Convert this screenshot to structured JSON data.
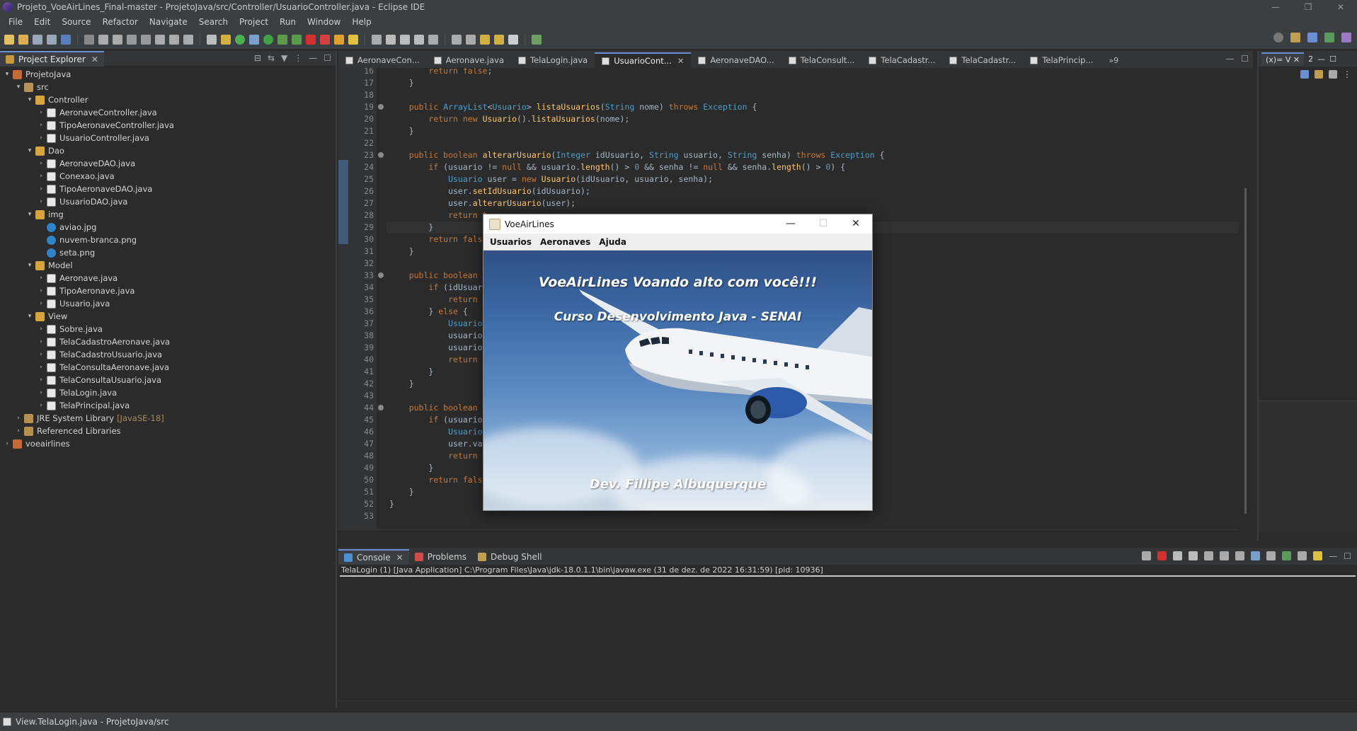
{
  "window": {
    "title": "Projeto_VoeAirLines_Final-master - ProjetoJava/src/Controller/UsuarioController.java - Eclipse IDE",
    "controls": [
      "—",
      "❐",
      "✕"
    ]
  },
  "menu": [
    "File",
    "Edit",
    "Source",
    "Refactor",
    "Navigate",
    "Search",
    "Project",
    "Run",
    "Window",
    "Help"
  ],
  "project_explorer": {
    "tab_label": "Project Explorer",
    "tree": [
      {
        "label": "ProjetoJava",
        "depth": 0,
        "arrow": "▾",
        "icon": "project",
        "name": "tree-project"
      },
      {
        "label": "src",
        "depth": 1,
        "arrow": "▾",
        "icon": "pkgfolder",
        "name": "tree-src"
      },
      {
        "label": "Controller",
        "depth": 2,
        "arrow": "▾",
        "icon": "package",
        "name": "tree-package"
      },
      {
        "label": "AeronaveController.java",
        "depth": 3,
        "arrow": "›",
        "icon": "java",
        "name": "tree-file"
      },
      {
        "label": "TipoAeronaveController.java",
        "depth": 3,
        "arrow": "›",
        "icon": "java",
        "name": "tree-file"
      },
      {
        "label": "UsuarioController.java",
        "depth": 3,
        "arrow": "›",
        "icon": "java",
        "name": "tree-file"
      },
      {
        "label": "Dao",
        "depth": 2,
        "arrow": "▾",
        "icon": "package",
        "name": "tree-package"
      },
      {
        "label": "AeronaveDAO.java",
        "depth": 3,
        "arrow": "›",
        "icon": "java",
        "name": "tree-file"
      },
      {
        "label": "Conexao.java",
        "depth": 3,
        "arrow": "›",
        "icon": "java",
        "name": "tree-file"
      },
      {
        "label": "TipoAeronaveDAO.java",
        "depth": 3,
        "arrow": "›",
        "icon": "java",
        "name": "tree-file"
      },
      {
        "label": "UsuarioDAO.java",
        "depth": 3,
        "arrow": "›",
        "icon": "java",
        "name": "tree-file"
      },
      {
        "label": "img",
        "depth": 2,
        "arrow": "▾",
        "icon": "package",
        "name": "tree-package"
      },
      {
        "label": "aviao.jpg",
        "depth": 3,
        "arrow": "",
        "icon": "image",
        "name": "tree-file"
      },
      {
        "label": "nuvem-branca.png",
        "depth": 3,
        "arrow": "",
        "icon": "image",
        "name": "tree-file"
      },
      {
        "label": "seta.png",
        "depth": 3,
        "arrow": "",
        "icon": "image",
        "name": "tree-file"
      },
      {
        "label": "Model",
        "depth": 2,
        "arrow": "▾",
        "icon": "package",
        "name": "tree-package"
      },
      {
        "label": "Aeronave.java",
        "depth": 3,
        "arrow": "›",
        "icon": "java",
        "name": "tree-file"
      },
      {
        "label": "TipoAeronave.java",
        "depth": 3,
        "arrow": "›",
        "icon": "java",
        "name": "tree-file"
      },
      {
        "label": "Usuario.java",
        "depth": 3,
        "arrow": "›",
        "icon": "java",
        "name": "tree-file"
      },
      {
        "label": "View",
        "depth": 2,
        "arrow": "▾",
        "icon": "package",
        "name": "tree-package"
      },
      {
        "label": "Sobre.java",
        "depth": 3,
        "arrow": "›",
        "icon": "java",
        "name": "tree-file"
      },
      {
        "label": "TelaCadastroAeronave.java",
        "depth": 3,
        "arrow": "›",
        "icon": "java",
        "name": "tree-file"
      },
      {
        "label": "TelaCadastroUsuario.java",
        "depth": 3,
        "arrow": "›",
        "icon": "java",
        "name": "tree-file"
      },
      {
        "label": "TelaConsultaAeronave.java",
        "depth": 3,
        "arrow": "›",
        "icon": "java",
        "name": "tree-file"
      },
      {
        "label": "TelaConsultaUsuario.java",
        "depth": 3,
        "arrow": "›",
        "icon": "java",
        "name": "tree-file"
      },
      {
        "label": "TelaLogin.java",
        "depth": 3,
        "arrow": "›",
        "icon": "java",
        "name": "tree-file"
      },
      {
        "label": "TelaPrincipal.java",
        "depth": 3,
        "arrow": "›",
        "icon": "java",
        "name": "tree-file"
      },
      {
        "label": "JRE System Library",
        "decor": "[JavaSE-18]",
        "depth": 1,
        "arrow": "›",
        "icon": "lib",
        "name": "tree-jre"
      },
      {
        "label": "Referenced Libraries",
        "depth": 1,
        "arrow": "›",
        "icon": "lib",
        "name": "tree-libs"
      },
      {
        "label": "voeairlines",
        "depth": 0,
        "arrow": "›",
        "icon": "project",
        "name": "tree-project"
      }
    ]
  },
  "editor": {
    "tabs": [
      {
        "label": "AeronaveCon...",
        "active": false
      },
      {
        "label": "Aeronave.java",
        "active": false
      },
      {
        "label": "TelaLogin.java",
        "active": false
      },
      {
        "label": "UsuarioCont...",
        "active": true
      },
      {
        "label": "AeronaveDAO...",
        "active": false
      },
      {
        "label": "TelaConsult...",
        "active": false
      },
      {
        "label": "TelaCadastr...",
        "active": false
      },
      {
        "label": "TelaCadastr...",
        "active": false
      },
      {
        "label": "TelaPrincip...",
        "active": false
      }
    ],
    "more_tabs": "»9",
    "lines": [
      {
        "n": "16",
        "html": "        <span class=\"kw\">return false</span>;"
      },
      {
        "n": "17",
        "html": "    }"
      },
      {
        "n": "18",
        "html": ""
      },
      {
        "n": "19",
        "fold": true,
        "html": "    <span class=\"kw\">public</span> <span class=\"ty\">ArrayList</span>&lt;<span class=\"ty\">Usuario</span>&gt; <span class=\"fn\">listaUsuarios</span>(<span class=\"ty\">String</span> nome) <span class=\"kw\">throws</span> <span class=\"ty\">Exception</span> {"
      },
      {
        "n": "20",
        "html": "        <span class=\"kw\">return new</span> <span class=\"fn\">Usuario</span>().<span class=\"fn\">listaUsuarios</span>(nome);"
      },
      {
        "n": "21",
        "html": "    }"
      },
      {
        "n": "22",
        "html": ""
      },
      {
        "n": "23",
        "fold": true,
        "html": "    <span class=\"kw\">public boolean</span> <span class=\"fn\">alterarUsuario</span>(<span class=\"ty\">Integer</span> idUsuario, <span class=\"ty\">String</span> usuario, <span class=\"ty\">String</span> senha) <span class=\"kw\">throws</span> <span class=\"ty\">Exception</span> {"
      },
      {
        "n": "24",
        "html": "        <span class=\"kw\">if</span> (usuario != <span class=\"kw\">null</span> &amp;&amp; usuario.<span class=\"fn\">length</span>() &gt; <span class=\"nm\">0</span> &amp;&amp; senha != <span class=\"kw\">null</span> &amp;&amp; senha.<span class=\"fn\">length</span>() &gt; <span class=\"nm\">0</span>) {"
      },
      {
        "n": "25",
        "html": "            <span class=\"ty\">Usuario</span> user = <span class=\"kw\">new</span> <span class=\"fn\">Usuario</span>(idUsuario, usuario, senha);"
      },
      {
        "n": "26",
        "html": "            user.<span class=\"fn\">setIdUsuario</span>(idUsuario);"
      },
      {
        "n": "27",
        "html": "            user.<span class=\"fn\">alterarUsuario</span>(user);"
      },
      {
        "n": "28",
        "html": "            <span class=\"kw\">return t</span>"
      },
      {
        "n": "29",
        "current": true,
        "html": "        }"
      },
      {
        "n": "30",
        "html": "        <span class=\"kw\">return false</span>"
      },
      {
        "n": "31",
        "html": "    }"
      },
      {
        "n": "32",
        "html": ""
      },
      {
        "n": "33",
        "fold": true,
        "html": "    <span class=\"kw\">public boolean</span> <span class=\"fn\">a</span>"
      },
      {
        "n": "34",
        "html": "        <span class=\"kw\">if</span> (idUsuari"
      },
      {
        "n": "35",
        "html": "            <span class=\"kw\">return f</span>"
      },
      {
        "n": "36",
        "html": "        } <span class=\"kw\">else</span> {"
      },
      {
        "n": "37",
        "html": "            <span class=\"ty\">Usuario</span> "
      },
      {
        "n": "38",
        "html": "            usuario."
      },
      {
        "n": "39",
        "html": "            usuario."
      },
      {
        "n": "40",
        "html": "            <span class=\"kw\">return t</span>"
      },
      {
        "n": "41",
        "html": "        }"
      },
      {
        "n": "42",
        "html": "    }"
      },
      {
        "n": "43",
        "html": ""
      },
      {
        "n": "44",
        "fold": true,
        "html": "    <span class=\"kw\">public boolean</span> <span class=\"fn\">v</span>"
      },
      {
        "n": "45",
        "html": "        <span class=\"kw\">if</span> (usuario                                                      <span class=\"nm\">0</span>) {"
      },
      {
        "n": "46",
        "html": "            <span class=\"ty\">Usuario</span> "
      },
      {
        "n": "47",
        "html": "            user.val"
      },
      {
        "n": "48",
        "html": "            <span class=\"kw\">return t</span>"
      },
      {
        "n": "49",
        "html": "        }"
      },
      {
        "n": "50",
        "html": "        <span class=\"kw\">return false</span>"
      },
      {
        "n": "51",
        "html": "    }"
      },
      {
        "n": "52",
        "html": "}"
      },
      {
        "n": "53",
        "html": ""
      }
    ]
  },
  "right_panel": {
    "tab_label": "V",
    "tab_count": "2"
  },
  "console": {
    "tabs": [
      {
        "label": "Console",
        "active": true,
        "closable": true
      },
      {
        "label": "Problems",
        "active": false
      },
      {
        "label": "Debug Shell",
        "active": false
      }
    ],
    "header": "TelaLogin (1) [Java Application] C:\\Program Files\\Java\\jdk-18.0.1.1\\bin\\javaw.exe  (31 de dez. de 2022 16:31:59) [pid: 10936]"
  },
  "status_bar": {
    "text": "View.TelaLogin.java - ProjetoJava/src"
  },
  "swing_window": {
    "title": "VoeAirLines",
    "menu": [
      "Usuarios",
      "Aeronaves",
      "Ajuda"
    ],
    "heading": "VoeAirLines Voando alto com você!!!",
    "subheading": "Curso Desenvolvimento Java - SENAI",
    "footer": "Dev. Fillipe Albuquerque",
    "controls": [
      "—",
      "☐",
      "✕"
    ]
  },
  "colors": {
    "accent": "#6a8fd4",
    "keyword": "#cc7832",
    "type": "#4e9ec7",
    "number": "#6897bb",
    "method": "#ffc66d"
  }
}
